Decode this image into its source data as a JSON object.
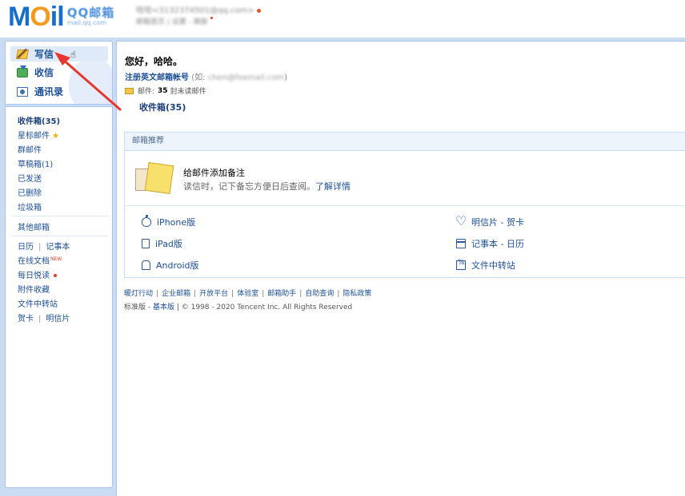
{
  "header": {
    "logo_text": "MOil",
    "logo_qq": "QQ邮箱",
    "logo_domain": "mail.qq.com",
    "user_line1": "哈哈<3132374501@qq.com>",
    "user_line2": "邮箱首页 | 设置 - 换肤"
  },
  "sidebar": {
    "actions": [
      {
        "label": "写信",
        "icon": "pencil-note-icon"
      },
      {
        "label": "收信",
        "icon": "inbox-download-icon"
      },
      {
        "label": "通讯录",
        "icon": "contacts-card-icon"
      }
    ],
    "folders": {
      "inbox": "收件箱(35)",
      "starred": "星标邮件",
      "groups": "群邮件",
      "drafts": "草稿箱(1)",
      "sent": "已发送",
      "deleted": "已删除",
      "spam": "垃圾箱"
    },
    "other_mailboxes": "其他邮箱",
    "tools": {
      "calendar": "日历",
      "notes": "记事本",
      "online_docs": "在线文档",
      "new_badge": "NEW",
      "daily_reading": "每日悦读",
      "attachments": "附件收藏",
      "file_transfer": "文件中转站",
      "cards": "贺卡",
      "postcards": "明信片"
    }
  },
  "main": {
    "greeting": "您好，哈哈。",
    "register_link": "注册英文邮箱帐号",
    "register_hint_prefix": "(如:",
    "register_hint_example": "chen@foxmail.com",
    "register_hint_suffix": ")",
    "unread_prefix": "邮件:",
    "unread_count": "35",
    "unread_suffix": "封未读邮件",
    "inbox_link": "收件箱(35)",
    "recommend": {
      "title": "邮箱推荐",
      "note_title": "给邮件添加备注",
      "note_desc": "读信时，记下备忘方便日后查阅。",
      "note_link": "了解详情"
    },
    "apps": {
      "iphone": "iPhone版",
      "ipad": "iPad版",
      "android": "Android版",
      "postcard": "明信片 - 贺卡",
      "notebook": "记事本 - 日历",
      "file_transfer": "文件中转站"
    },
    "footer": {
      "links": [
        "暖灯行动",
        "企业邮箱",
        "开放平台",
        "体验室",
        "邮箱助手",
        "自助查询",
        "隐私政策"
      ],
      "standard": "标准版",
      "dash": " - ",
      "basic": "基本版",
      "copyright": " | © 1998 - 2020 Tencent Inc. All Rights Reserved"
    }
  },
  "colors": {
    "brand_blue": "#1a6ec8",
    "brand_orange": "#f29b1d",
    "link_blue": "#1c4f95",
    "frame_blue": "#c9dcf3",
    "annotation_red": "#e8372f"
  }
}
